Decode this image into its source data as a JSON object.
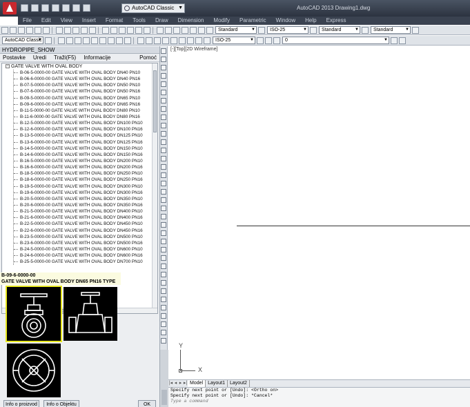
{
  "app": {
    "workspace": "AutoCAD Classic",
    "window_title": "AutoCAD 2013   Drawing1.dwg"
  },
  "menu": [
    "File",
    "Edit",
    "View",
    "Insert",
    "Format",
    "Tools",
    "Draw",
    "Dimension",
    "Modify",
    "Parametric",
    "Window",
    "Help",
    "Express"
  ],
  "toolbar": {
    "text_style": "Standard",
    "dim_style": "ISO-25",
    "table_style": "Standard",
    "mleader_style": "Standard",
    "workspace_combo": "AutoCAD Classic",
    "layer": "0",
    "scale": "ISO-25"
  },
  "palette": {
    "title": "HYDROPIPE_SHOW",
    "menu": [
      "Postavke",
      "Uredi",
      "Traži(F5)",
      "Informacije"
    ],
    "help": "Pomoć",
    "tree_root": "GATE VALVE WITH OVAL BODY",
    "items": [
      "B-06-5-0000-00 GATE VALVE WITH OVAL BODY DN40 PN10",
      "B-06-6-0000-00 GATE VALVE WITH OVAL BODY DN40 PN16",
      "B-07-5-0000-00 GATE VALVE WITH OVAL BODY DN50 PN10",
      "B-07-6-0000-00 GATE VALVE WITH OVAL BODY DN50 PN16",
      "B-09-5-0000-00 GATE VALVE WITH OVAL BODY DN65 PN10",
      "B-09-6-0000-00 GATE VALVE WITH OVAL BODY DN65 PN16",
      "B-11-5-0000-00 GATE VALVE WITH OVAL BODY DN80 PN10",
      "B-11-6-0000-00 GATE VALVE WITH OVAL BODY DN80 PN16",
      "B-12-5-0000-00 GATE VALVE WITH OVAL BODY DN100 PN10",
      "B-12-6-0000-00 GATE VALVE WITH OVAL BODY DN100 PN16",
      "B-13-5-0000-00 GATE VALVE WITH OVAL BODY DN125 PN10",
      "B-13-6-0000-00 GATE VALVE WITH OVAL BODY DN125 PN16",
      "B-14-5-0000-00 GATE VALVE WITH OVAL BODY DN150 PN10",
      "B-14-6-0000-00 GATE VALVE WITH OVAL BODY DN150 PN16",
      "B-16-5-0000-00 GATE VALVE WITH OVAL BODY DN200 PN10",
      "B-16-6-0000-00 GATE VALVE WITH OVAL BODY DN200 PN16",
      "B-18-5-0000-00 GATE VALVE WITH OVAL BODY DN250 PN10",
      "B-18-6-0000-00 GATE VALVE WITH OVAL BODY DN250 PN16",
      "B-19-5-0000-00 GATE VALVE WITH OVAL BODY DN300 PN10",
      "B-19-6-0000-00 GATE VALVE WITH OVAL BODY DN300 PN16",
      "B-20-5-0000-00 GATE VALVE WITH OVAL BODY DN350 PN10",
      "B-20-6-0000-00 GATE VALVE WITH OVAL BODY DN350 PN16",
      "B-21-5-0000-00 GATE VALVE WITH OVAL BODY DN400 PN10",
      "B-21-6-0000-00 GATE VALVE WITH OVAL BODY DN400 PN16",
      "B-22-5-0000-00 GATE VALVE WITH OVAL BODY DN450 PN10",
      "B-22-6-0000-00 GATE VALVE WITH OVAL BODY DN450 PN16",
      "B-23-5-0000-00 GATE VALVE WITH OVAL BODY DN500 PN10",
      "B-23-6-0000-00 GATE VALVE WITH OVAL BODY DN500 PN16",
      "B-24-5-0000-00 GATE VALVE WITH OVAL BODY DN600 PN10",
      "B-24-6-0000-00 GATE VALVE WITH OVAL BODY DN600 PN16",
      "B-25-5-0000-00 GATE VALVE WITH OVAL BODY DN700 PN10"
    ],
    "selected_code": "B-09-6-0000-00",
    "selected_desc": "GATE VALVE WITH OVAL BODY DN65 PN16 TYPE",
    "btn_info_product": "Info o proizvod",
    "btn_info_object": "Info o Objektu",
    "btn_ok": "OK"
  },
  "viewport": {
    "label": "[-][Top][2D Wireframe]",
    "ucs_x": "X",
    "ucs_y": "Y"
  },
  "layout_tabs": [
    "Model",
    "Layout1",
    "Layout2"
  ],
  "command_history": [
    "Specify next point or [Undo]:  <Ortho on>",
    "Specify next point or [Undo]: *Cancel*"
  ],
  "command_prompt": "Type a command"
}
